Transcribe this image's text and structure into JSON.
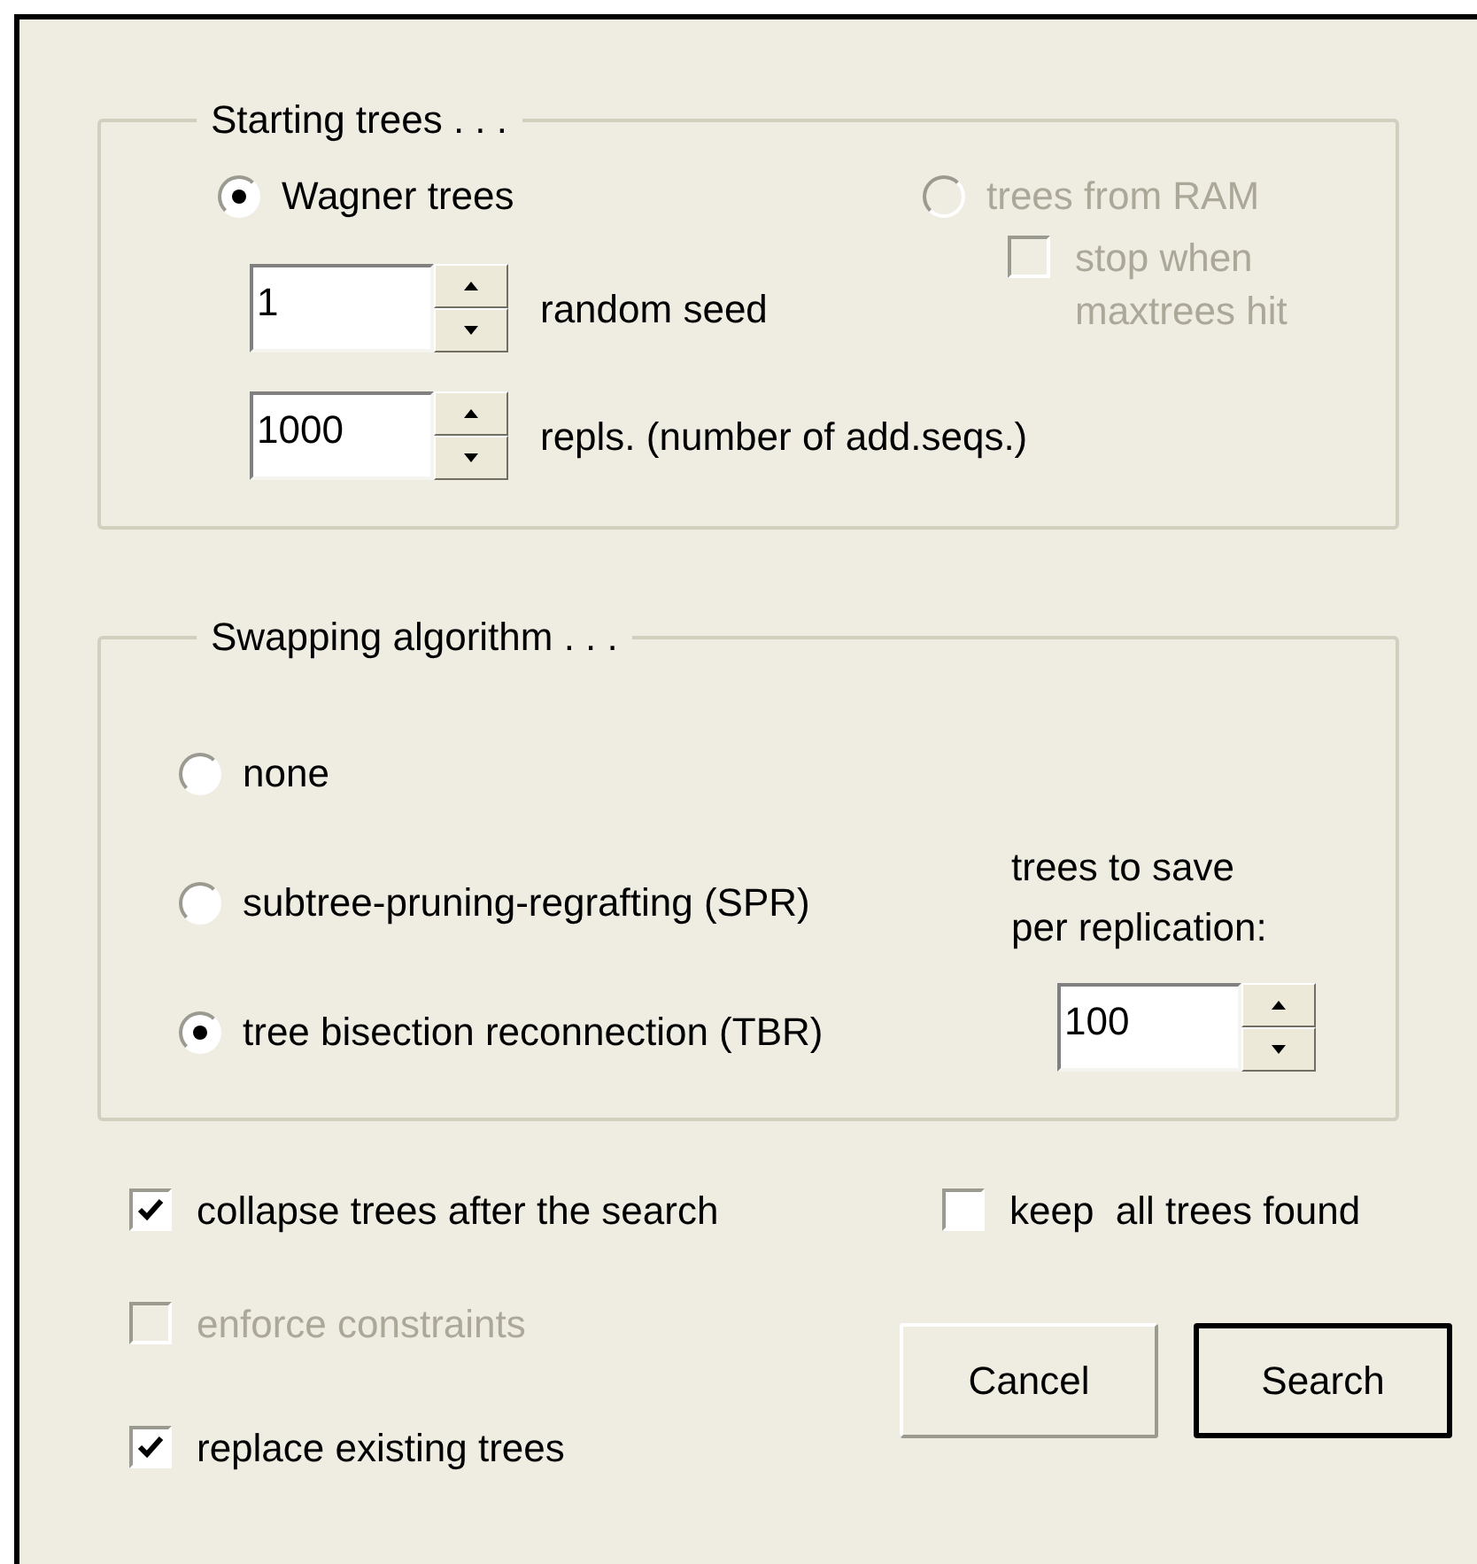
{
  "starting_trees": {
    "title": "Starting trees . . .",
    "options": [
      {
        "label": "Wagner trees",
        "selected": true,
        "disabled": false
      },
      {
        "label": "trees from RAM",
        "selected": false,
        "disabled": true
      }
    ],
    "spinners": [
      {
        "value": "1",
        "label": "random seed"
      },
      {
        "value": "1000",
        "label": "repls. (number of add.seqs.)"
      }
    ],
    "stop_checkbox": {
      "label_lines": [
        "stop when",
        "maxtrees hit"
      ],
      "checked": false,
      "disabled": true
    }
  },
  "swapping": {
    "title": "Swapping algorithm . . .",
    "options": [
      {
        "label": "none",
        "selected": false
      },
      {
        "label": "subtree-pruning-regrafting (SPR)",
        "selected": false
      },
      {
        "label": "tree bisection reconnection (TBR)",
        "selected": true
      }
    ],
    "trees_to_save": {
      "label_lines": [
        "trees to save",
        "per replication:"
      ],
      "value": "100"
    }
  },
  "options": [
    {
      "label": "collapse trees after the search",
      "checked": true,
      "disabled": false
    },
    {
      "label": "keep  all trees found",
      "checked": false,
      "disabled": false
    },
    {
      "label": "enforce constraints",
      "checked": false,
      "disabled": true
    },
    {
      "label": "replace existing trees",
      "checked": true,
      "disabled": false
    }
  ],
  "buttons": [
    {
      "label": "Cancel",
      "default": false
    },
    {
      "label": "Search",
      "default": true
    }
  ]
}
